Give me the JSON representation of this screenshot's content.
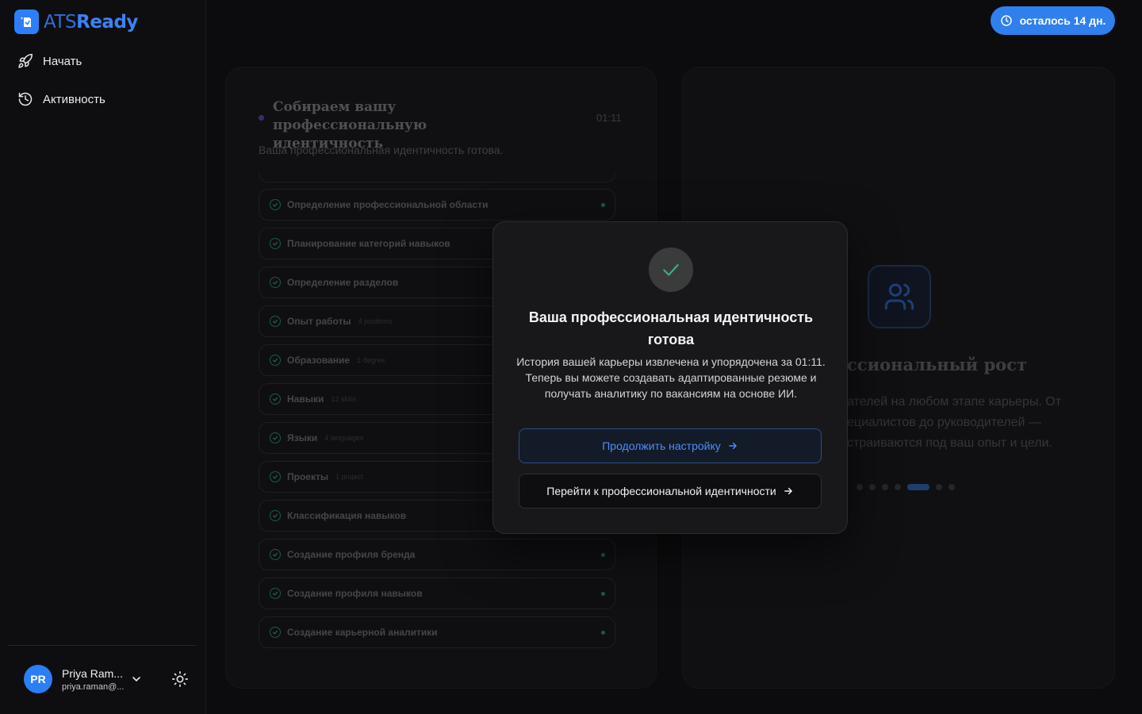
{
  "app": {
    "logo_ats": "ATS",
    "logo_ready": "Ready"
  },
  "nav": {
    "start": "Начать",
    "activity": "Активность"
  },
  "user": {
    "initials": "PR",
    "name": "Priya Ram...",
    "email": "priya.raman@..."
  },
  "trial": {
    "label": "осталось 14 дн."
  },
  "progress_panel": {
    "title": "Собираем вашу профессиональную идентичность",
    "time": "01:11",
    "subtitle": "Ваша профессиональная идентичность готова.",
    "steps": [
      {
        "label": "Определение профессиональной области",
        "count": ""
      },
      {
        "label": "Планирование категорий навыков",
        "count": ""
      },
      {
        "label": "Определение разделов",
        "count": ""
      },
      {
        "label": "Опыт работы",
        "count": "4 positions"
      },
      {
        "label": "Образование",
        "count": "1 degree"
      },
      {
        "label": "Навыки",
        "count": "12 skills"
      },
      {
        "label": "Языки",
        "count": "4 languages"
      },
      {
        "label": "Проекты",
        "count": "1 project"
      },
      {
        "label": "Классификация навыков",
        "count": ""
      },
      {
        "label": "Создание профиля бренда",
        "count": ""
      },
      {
        "label": "Создание профиля навыков",
        "count": ""
      },
      {
        "label": "Создание карьерной аналитики",
        "count": ""
      }
    ]
  },
  "info_panel": {
    "title": "ссиональный рост",
    "description": "ателей на любом этапе карьеры. От ециалистов до руководителей — страиваются под ваш опыт и цели.",
    "slide_count": 7,
    "active_slide": 5
  },
  "modal": {
    "title": "Ваша профессиональная идентичность готова",
    "text": "История вашей карьеры извлечена и упорядочена за 01:11. Теперь вы можете создавать адаптированные резюме и получать аналитику по вакансиям на основе ИИ.",
    "primary_label": "Продолжить настройку",
    "secondary_label": "Перейти к профессиональной идентичности"
  },
  "colors": {
    "accent": "#2f80ed",
    "success": "#3fae7a"
  }
}
